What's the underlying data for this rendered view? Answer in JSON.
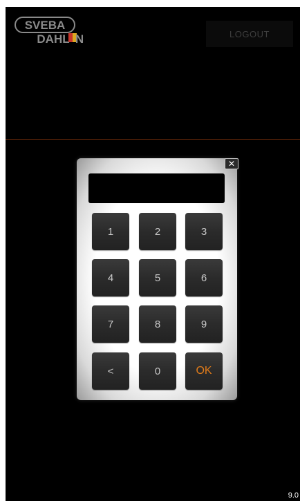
{
  "logo": {
    "line1": "SVEBA",
    "line2": "DAHLEN",
    "accent": "#c8342a"
  },
  "header": {
    "logout_label": "LOGOUT"
  },
  "keypad": {
    "display_value": "",
    "close_label": "✕",
    "keys": [
      "1",
      "2",
      "3",
      "4",
      "5",
      "6",
      "7",
      "8",
      "9",
      "<",
      "0",
      "OK"
    ],
    "ok_color": "#e07b1a"
  },
  "footer": {
    "version": "9.0"
  }
}
